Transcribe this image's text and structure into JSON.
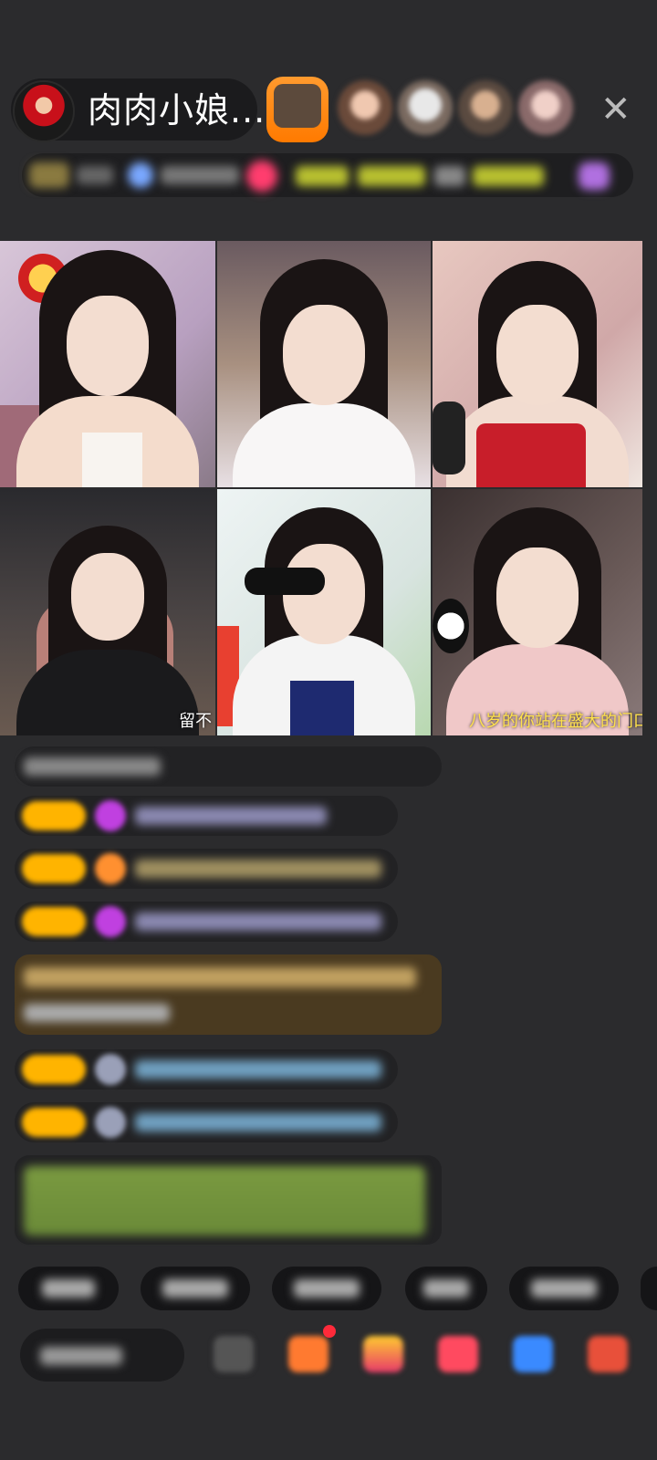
{
  "header": {
    "host_name": "肉肉小娘...",
    "close_icon": "close-icon"
  },
  "grid": {
    "tiles": [
      {
        "id": "1",
        "caption": ""
      },
      {
        "id": "2",
        "caption": ""
      },
      {
        "id": "3",
        "caption": ""
      },
      {
        "id": "4",
        "caption": "留不"
      },
      {
        "id": "5",
        "caption": ""
      },
      {
        "id": "6",
        "caption": "八岁的你站在盛大的门口"
      }
    ]
  },
  "colors": {
    "background": "#2b2b2d",
    "badge": "#ffb400",
    "accent_pink": "#ff3d6e",
    "highlight_row": "#4a3a20"
  }
}
